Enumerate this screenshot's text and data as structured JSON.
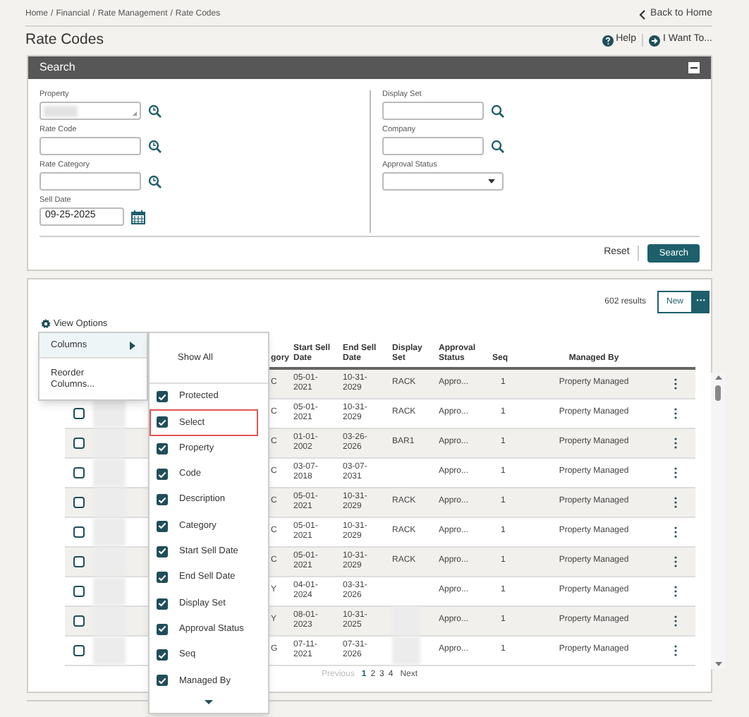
{
  "breadcrumb": [
    "Home",
    "Financial",
    "Rate Management",
    "Rate Codes"
  ],
  "breadcrumb_separator": "/",
  "back_link": "Back to Home",
  "title": "Rate Codes",
  "header_actions": [
    {
      "label": "Help",
      "kind": "help"
    },
    {
      "label": "I Want To...",
      "kind": "go"
    }
  ],
  "search_panel": {
    "title": "Search",
    "left_fields": [
      {
        "label": "Property",
        "kind": "lookup",
        "blurred": true
      },
      {
        "label": "Rate Code",
        "kind": "lookup"
      },
      {
        "label": "Rate Category",
        "kind": "lookup"
      },
      {
        "label": "Sell Date",
        "kind": "date",
        "value": "09-25-2025"
      }
    ],
    "right_fields": [
      {
        "label": "Display Set",
        "kind": "search"
      },
      {
        "label": "Company",
        "kind": "search"
      },
      {
        "label": "Approval Status",
        "kind": "select"
      }
    ],
    "buttons": [
      "Reset",
      "Search"
    ]
  },
  "results": {
    "count": "602 results",
    "new_button": "New",
    "more_button": "···",
    "view_options": "View Options",
    "columns": [
      "gory",
      "Start Sell Date",
      "End Sell Date",
      "Display Set",
      "Approval Status",
      "Seq",
      "Managed By"
    ],
    "rows": [
      {
        "category": "C",
        "start": "05-01-2021",
        "end": "10-31-2029",
        "display_set": "RACK",
        "status": "Appro...",
        "seq": "1",
        "managed_by": "Property Managed"
      },
      {
        "checked": false,
        "property_blurred": true,
        "category": "C",
        "start": "05-01-2021",
        "end": "10-31-2029",
        "display_set": "RACK",
        "status": "Appro...",
        "seq": "1",
        "managed_by": "Property Managed"
      },
      {
        "checked": false,
        "property_blurred": true,
        "category": "C",
        "start": "01-01-2002",
        "end": "03-26-2026",
        "display_set": "BAR1",
        "status": "Appro...",
        "seq": "1",
        "managed_by": "Property Managed"
      },
      {
        "checked": false,
        "property_blurred": true,
        "category": "C",
        "start": "03-07-2018",
        "end": "03-07-2031",
        "status": "Appro...",
        "seq": "1",
        "managed_by": "Property Managed"
      },
      {
        "checked": false,
        "property_blurred": true,
        "category": "C",
        "start": "05-01-2021",
        "end": "10-31-2029",
        "display_set": "RACK",
        "status": "Appro...",
        "seq": "1",
        "managed_by": "Property Managed"
      },
      {
        "checked": false,
        "property_blurred": true,
        "category": "C",
        "start": "05-01-2021",
        "end": "10-31-2029",
        "display_set": "RACK",
        "status": "Appro...",
        "seq": "1",
        "managed_by": "Property Managed"
      },
      {
        "checked": false,
        "property_blurred": true,
        "category": "C",
        "start": "05-01-2021",
        "end": "10-31-2029",
        "display_set": "RACK",
        "status": "Appro...",
        "seq": "1",
        "managed_by": "Property Managed"
      },
      {
        "checked": false,
        "property_blurred": true,
        "category": "Y",
        "start": "04-01-2024",
        "end": "03-31-2026",
        "status": "Appro...",
        "seq": "1",
        "managed_by": "Property Managed"
      },
      {
        "checked": false,
        "property_blurred": true,
        "category": "Y",
        "start": "08-01-2023",
        "end": "10-31-2025",
        "display_set_blurred": true,
        "status": "Appro...",
        "seq": "1",
        "managed_by": "Property Managed"
      },
      {
        "checked": false,
        "property_blurred": true,
        "category": "G",
        "start": "07-11-2021",
        "end": "07-31-2026",
        "display_set_blurred": true,
        "status": "Appro...",
        "seq": "1",
        "managed_by": "Property Managed"
      }
    ],
    "pagination": [
      {
        "label": "Previous",
        "kind": "nav",
        "disabled": true
      },
      {
        "label": "1",
        "kind": "page",
        "selected": true
      },
      {
        "label": "2",
        "kind": "page",
        "selected": false
      },
      {
        "label": "3",
        "kind": "page",
        "selected": false
      },
      {
        "label": "4",
        "kind": "page",
        "selected": false
      },
      {
        "label": "Next",
        "kind": "nav",
        "disabled": false
      }
    ]
  },
  "view_menu": {
    "items": [
      {
        "label": "Columns",
        "selected": true,
        "submenu": true
      },
      {
        "label": "Reorder Columns...",
        "selected": false,
        "submenu": false
      }
    ],
    "columns_submenu": {
      "show_all": "Show All",
      "items": [
        {
          "label": "Protected",
          "checked": true,
          "highlighted": false
        },
        {
          "label": "Select",
          "checked": true,
          "highlighted": true
        },
        {
          "label": "Property",
          "checked": true,
          "highlighted": false
        },
        {
          "label": "Code",
          "checked": true,
          "highlighted": false
        },
        {
          "label": "Description",
          "checked": true,
          "highlighted": false
        },
        {
          "label": "Category",
          "checked": true,
          "highlighted": false
        },
        {
          "label": "Start Sell Date",
          "checked": true,
          "highlighted": false
        },
        {
          "label": "End Sell Date",
          "checked": true,
          "highlighted": false
        },
        {
          "label": "Display Set",
          "checked": true,
          "highlighted": false
        },
        {
          "label": "Approval Status",
          "checked": true,
          "highlighted": false
        },
        {
          "label": "Seq",
          "checked": true,
          "highlighted": false
        },
        {
          "label": "Managed By",
          "checked": true,
          "highlighted": false
        }
      ]
    }
  }
}
